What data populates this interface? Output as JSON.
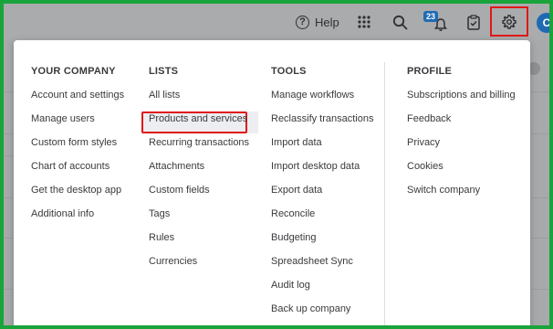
{
  "topbar": {
    "help_label": "Help",
    "help_icon": "question-circle-icon",
    "apps_icon": "grid-icon",
    "search_icon": "search-icon",
    "notifications_icon": "bell-icon",
    "notifications_count": "23",
    "tasks_icon": "clipboard-icon",
    "settings_icon": "gear-icon",
    "avatar_initial": "C"
  },
  "menu": {
    "your_company": {
      "heading": "YOUR COMPANY",
      "items": [
        "Account and settings",
        "Manage users",
        "Custom form styles",
        "Chart of accounts",
        "Get the desktop app",
        "Additional info"
      ]
    },
    "lists": {
      "heading": "LISTS",
      "items": [
        "All lists",
        "Products and services",
        "Recurring transactions",
        "Attachments",
        "Custom fields",
        "Tags",
        "Rules",
        "Currencies"
      ]
    },
    "tools": {
      "heading": "TOOLS",
      "items": [
        "Manage workflows",
        "Reclassify transactions",
        "Import data",
        "Import desktop data",
        "Export data",
        "Reconcile",
        "Budgeting",
        "Spreadsheet Sync",
        "Audit log",
        "Back up company"
      ]
    },
    "profile": {
      "heading": "PROFILE",
      "items": [
        "Subscriptions and billing",
        "Feedback",
        "Privacy",
        "Cookies",
        "Switch company"
      ]
    }
  },
  "colors": {
    "outer_border": "#19a33b",
    "highlight_border": "#e01818",
    "badge": "#1f6ab3"
  }
}
